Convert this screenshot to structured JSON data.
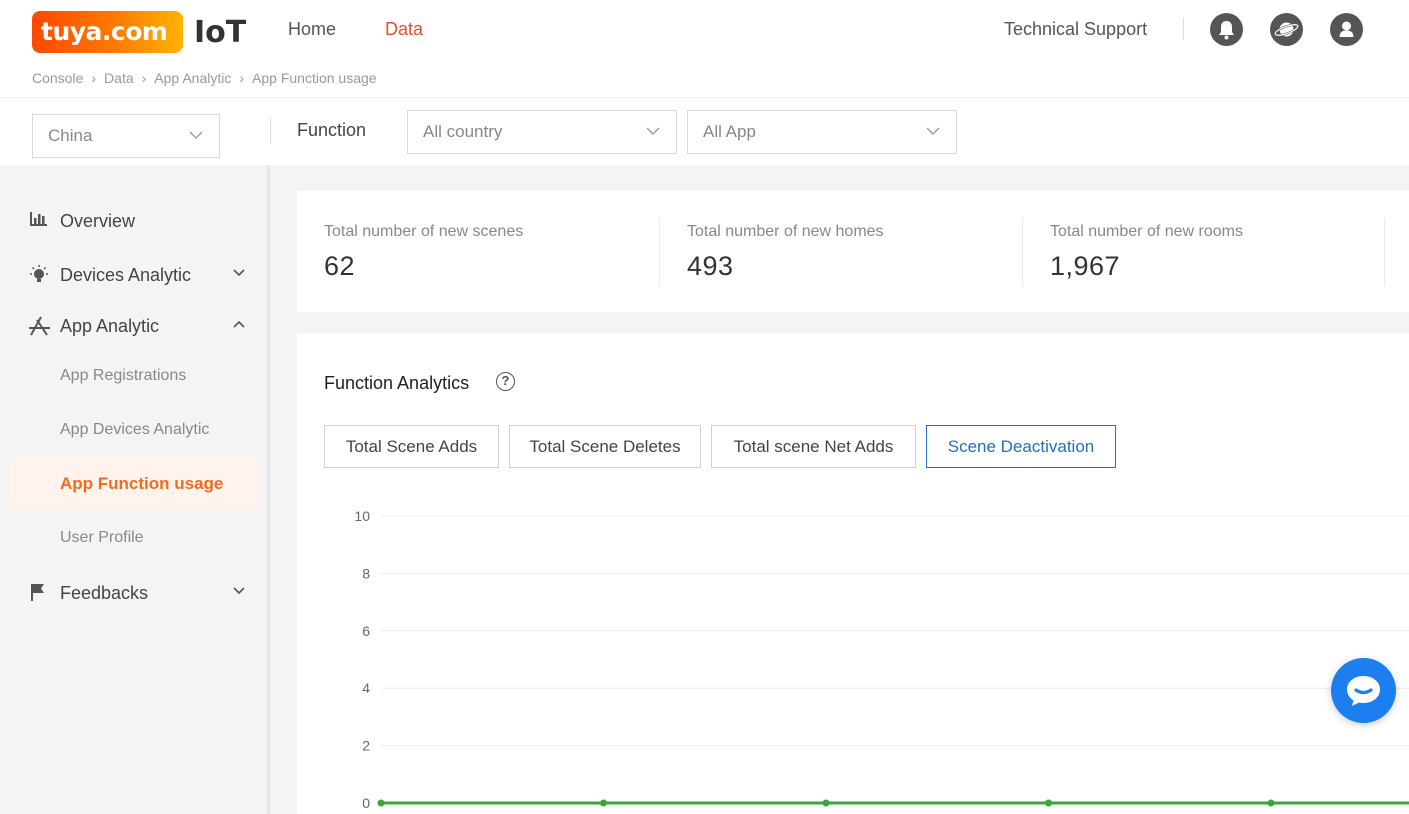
{
  "header": {
    "logo_text": "tuya.com",
    "product": "IoT",
    "nav": [
      "Home",
      "Data"
    ],
    "active_nav": "Data",
    "tech_support": "Technical Support"
  },
  "breadcrumb": [
    "Console",
    "Data",
    "App Analytic",
    "App Function usage"
  ],
  "filters": {
    "region": "China",
    "label": "Function",
    "country": "All country",
    "app": "All App"
  },
  "sidebar": {
    "items": [
      {
        "label": "Overview",
        "icon": "bar-chart-icon"
      },
      {
        "label": "Devices Analytic",
        "icon": "bulb-icon",
        "expanded": false
      },
      {
        "label": "App Analytic",
        "icon": "app-store-icon",
        "expanded": true
      },
      {
        "label": "Feedbacks",
        "icon": "flag-icon",
        "expanded": false
      }
    ],
    "subitems": [
      "App Registrations",
      "App Devices Analytic",
      "App Function usage",
      "User Profile"
    ],
    "active": "App Function usage"
  },
  "stats": [
    {
      "title": "Total number of new scenes",
      "value": "62"
    },
    {
      "title": "Total number of new homes",
      "value": "493"
    },
    {
      "title": "Total number of new rooms",
      "value": "1,967"
    }
  ],
  "panel": {
    "title": "Function Analytics",
    "help": "?",
    "tabs": [
      "Total Scene Adds",
      "Total Scene Deletes",
      "Total scene Net Adds",
      "Scene Deactivation"
    ],
    "active_tab": "Scene Deactivation"
  },
  "chart_data": {
    "type": "line",
    "yticks": [
      "10",
      "8",
      "6",
      "4",
      "2",
      "0"
    ],
    "ylim": [
      0,
      10
    ],
    "grid": true,
    "series": [
      {
        "color": "#3aa53a",
        "values": [
          0,
          0,
          0,
          0,
          0,
          0
        ]
      }
    ]
  }
}
